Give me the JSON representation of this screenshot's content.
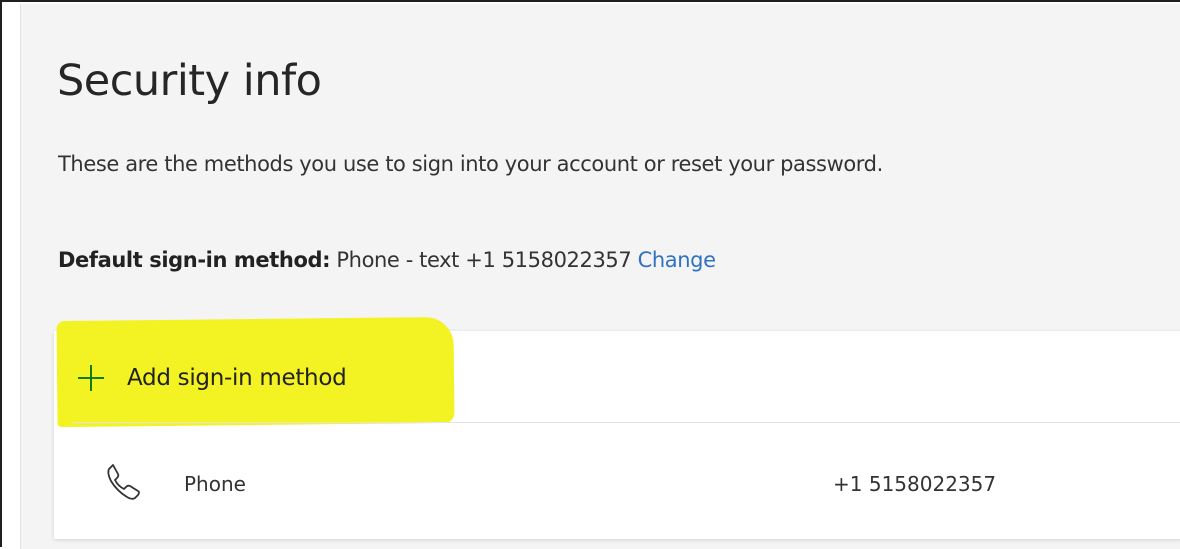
{
  "page": {
    "title": "Security info",
    "description": "These are the methods you use to sign into your account or reset your password."
  },
  "default_method": {
    "label": "Default sign-in method:",
    "value": "Phone - text +1 5158022357",
    "change_label": "Change"
  },
  "actions": {
    "add_method_label": "Add sign-in method"
  },
  "methods": [
    {
      "name": "Phone",
      "value": "+1 5158022357",
      "icon": "phone-icon"
    }
  ],
  "colors": {
    "accent_link": "#2f72c4",
    "plus_icon": "#107c10",
    "highlight": "#f3f21c"
  }
}
